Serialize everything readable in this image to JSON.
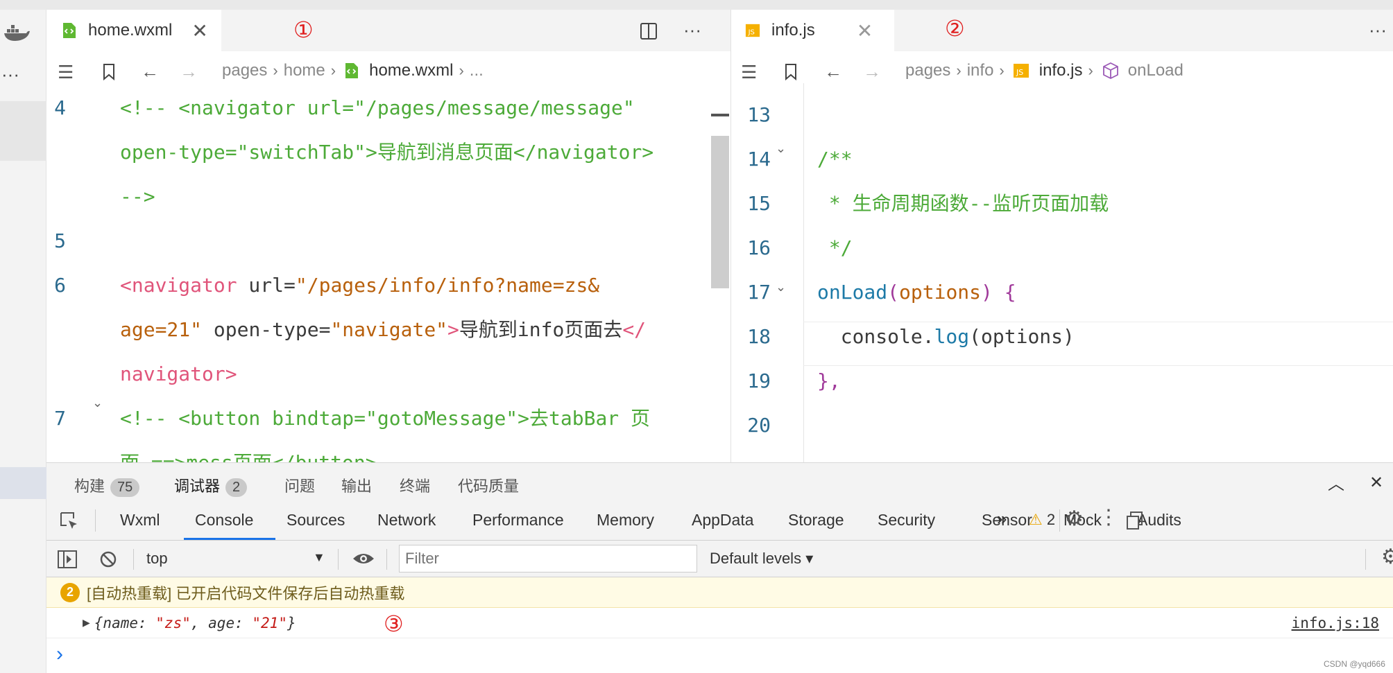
{
  "editor1": {
    "tab_title": "home.wxml",
    "tab_close": "✕",
    "split_icon": "split-editor-icon",
    "more": "···",
    "breadcrumb": [
      "pages",
      "home",
      "home.wxml",
      "..."
    ],
    "lines": [
      {
        "num": "4",
        "parts": [
          {
            "c": "cm",
            "t": "<!-- <navigator url=\"/pages/message/message\""
          }
        ]
      },
      {
        "num": "",
        "parts": [
          {
            "c": "cm",
            "t": "open-type=\"switchTab\">导航到消息页面</navigator>"
          }
        ]
      },
      {
        "num": "",
        "parts": [
          {
            "c": "cm",
            "t": "-->"
          }
        ]
      },
      {
        "num": "5",
        "parts": []
      },
      {
        "num": "6",
        "parts": [
          {
            "c": "tg",
            "t": "<navigator"
          },
          {
            "c": "at",
            "t": " url="
          },
          {
            "c": "st",
            "t": "\"/pages/info/info?name=zs&"
          }
        ]
      },
      {
        "num": "",
        "parts": [
          {
            "c": "st",
            "t": "age=21\""
          },
          {
            "c": "at",
            "t": " open-type="
          },
          {
            "c": "st",
            "t": "\"navigate\""
          },
          {
            "c": "tg",
            "t": ">"
          },
          {
            "c": "tx",
            "t": "导航到info页面去"
          },
          {
            "c": "tg",
            "t": "</"
          }
        ]
      },
      {
        "num": "",
        "parts": [
          {
            "c": "tg",
            "t": "navigator>"
          }
        ]
      },
      {
        "num": "7",
        "parts": [
          {
            "c": "cm",
            "t": "<!-- <button bindtap=\"gotoMessage\">去tabBar 页"
          }
        ]
      },
      {
        "num": "",
        "parts": [
          {
            "c": "cm",
            "t": "面 ==>mess页面</button>"
          }
        ]
      }
    ]
  },
  "editor2": {
    "tab_title": "info.js",
    "tab_close": "✕",
    "more": "···",
    "breadcrumb": [
      "pages",
      "info",
      "info.js",
      "onLoad"
    ],
    "lines": [
      {
        "num": "13",
        "parts": []
      },
      {
        "num": "14",
        "parts": [
          {
            "c": "cm",
            "t": "/**"
          }
        ]
      },
      {
        "num": "15",
        "parts": [
          {
            "c": "cm",
            "t": " * 生命周期函数--监听页面加载"
          }
        ]
      },
      {
        "num": "16",
        "parts": [
          {
            "c": "cm",
            "t": " */"
          }
        ]
      },
      {
        "num": "17",
        "parts": [
          {
            "c": "fn",
            "t": "onLoad"
          },
          {
            "c": "pp",
            "t": "("
          },
          {
            "c": "st",
            "t": "options"
          },
          {
            "c": "pp",
            "t": ")"
          },
          {
            "c": "vr",
            "t": " "
          },
          {
            "c": "pp",
            "t": "{"
          }
        ]
      },
      {
        "num": "18",
        "parts": [
          {
            "c": "vr",
            "t": "  console."
          },
          {
            "c": "fn",
            "t": "log"
          },
          {
            "c": "vr",
            "t": "(options)"
          }
        ]
      },
      {
        "num": "19",
        "parts": [
          {
            "c": "pp",
            "t": "},"
          }
        ]
      },
      {
        "num": "20",
        "parts": []
      }
    ]
  },
  "markers": {
    "m1": "①",
    "m2": "②",
    "m3": "③"
  },
  "panel": {
    "tabs": [
      {
        "label": "构建",
        "badge": "75"
      },
      {
        "label": "调试器",
        "badge": "2"
      },
      {
        "label": "问题",
        "badge": ""
      },
      {
        "label": "输出",
        "badge": ""
      },
      {
        "label": "终端",
        "badge": ""
      },
      {
        "label": "代码质量",
        "badge": ""
      }
    ],
    "devtools_tabs": [
      "Wxml",
      "Console",
      "Sources",
      "Network",
      "Performance",
      "Memory",
      "AppData",
      "Storage",
      "Security",
      "Sensor",
      "Mock",
      "Audits"
    ],
    "active_devtab": "Console",
    "warn_count": "2",
    "context": "top",
    "filter_placeholder": "Filter",
    "levels": "Default levels",
    "warn_badge": "2",
    "warn_message": "[自动热重载] 已开启代码文件保存后自动热重载",
    "log_message": "{name: \"zs\", age: \"21\"}",
    "log_source": "info.js:18",
    "prompt": "›"
  },
  "watermark": "CSDN @yqd666",
  "colors": {
    "accent": "#1a73e8",
    "comment": "#4caa38",
    "tag": "#e0547a",
    "string": "#b8600c",
    "marker": "#e02020"
  }
}
